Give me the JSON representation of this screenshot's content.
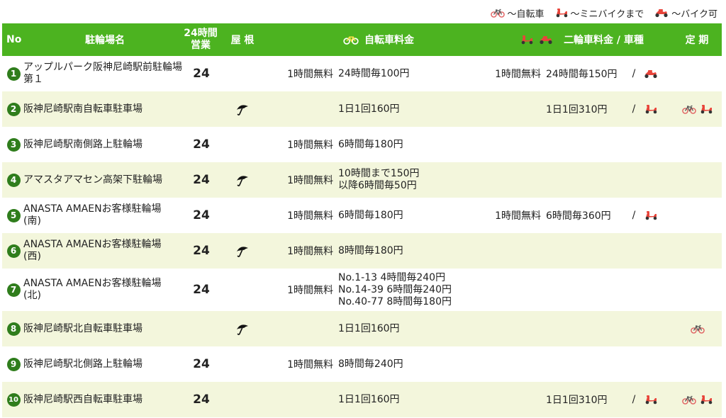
{
  "legend": [
    {
      "icon": "bicycle-icon",
      "label": "～自転車"
    },
    {
      "icon": "scooter-icon",
      "label": "～ミニバイクまで"
    },
    {
      "icon": "motorbike-icon",
      "label": "～バイク可"
    }
  ],
  "header": {
    "no": "No",
    "name": "駐輪場名",
    "hours_line1": "24時間",
    "hours_line2": "営業",
    "roof": "屋 根",
    "bike_fee": "自転車料金",
    "moto_fee": "二輪車料金 / 車種",
    "teiki": "定 期"
  },
  "rows": [
    {
      "no": "1",
      "name": "アップルパーク阪神尼崎駅前駐輪場第１",
      "hours": "24",
      "roof": false,
      "bike_free": "1時間無料",
      "bike_fee": "24時間毎100円",
      "moto_free": "1時間無料",
      "moto_fee": "24時間毎150円",
      "slash": "/",
      "moto_type": "motorbike",
      "teiki": []
    },
    {
      "no": "2",
      "name": "阪神尼崎駅南自転車駐車場",
      "hours": "",
      "roof": true,
      "bike_free": "",
      "bike_fee": "1日1回160円",
      "moto_free": "",
      "moto_fee": "1日1回310円",
      "slash": "/",
      "moto_type": "scooter",
      "teiki": [
        "bicycle",
        "scooter"
      ]
    },
    {
      "no": "3",
      "name": "阪神尼崎駅南側路上駐輪場",
      "hours": "24",
      "roof": false,
      "bike_free": "1時間無料",
      "bike_fee": "6時間毎180円",
      "moto_free": "",
      "moto_fee": "",
      "slash": "",
      "moto_type": "",
      "teiki": []
    },
    {
      "no": "4",
      "name": "アマスタアマセン高架下駐輪場",
      "hours": "24",
      "roof": true,
      "bike_free": "1時間無料",
      "bike_fee": "10時間まで150円\n以降6時間毎50円",
      "moto_free": "",
      "moto_fee": "",
      "slash": "",
      "moto_type": "",
      "teiki": []
    },
    {
      "no": "5",
      "name": "ANASTA AMAENお客様駐輪場\n(南)",
      "hours": "24",
      "roof": false,
      "bike_free": "1時間無料",
      "bike_fee": "6時間毎180円",
      "moto_free": "1時間無料",
      "moto_fee": "6時間毎360円",
      "slash": "/",
      "moto_type": "scooter",
      "teiki": []
    },
    {
      "no": "6",
      "name": "ANASTA AMAENお客様駐輪場\n(西)",
      "hours": "24",
      "roof": true,
      "bike_free": "1時間無料",
      "bike_fee": "8時間毎180円",
      "moto_free": "",
      "moto_fee": "",
      "slash": "",
      "moto_type": "",
      "teiki": []
    },
    {
      "no": "7",
      "name": "ANASTA AMAENお客様駐輪場\n(北)",
      "hours": "24",
      "roof": false,
      "bike_free": "1時間無料",
      "bike_fee": "No.1-13 4時間毎240円\nNo.14-39 6時間毎240円\nNo.40-77 8時間毎180円",
      "moto_free": "",
      "moto_fee": "",
      "slash": "",
      "moto_type": "",
      "teiki": []
    },
    {
      "no": "8",
      "name": "阪神尼崎駅北自転車駐車場",
      "hours": "",
      "roof": true,
      "bike_free": "",
      "bike_fee": "1日1回160円",
      "moto_free": "",
      "moto_fee": "",
      "slash": "",
      "moto_type": "",
      "teiki": [
        "bicycle"
      ]
    },
    {
      "no": "9",
      "name": "阪神尼崎駅北側路上駐輪場",
      "hours": "24",
      "roof": false,
      "bike_free": "1時間無料",
      "bike_fee": "8時間毎240円",
      "moto_free": "",
      "moto_fee": "",
      "slash": "",
      "moto_type": "",
      "teiki": []
    },
    {
      "no": "10",
      "name": "阪神尼崎駅西自転車駐車場",
      "hours": "24",
      "roof": false,
      "bike_free": "",
      "bike_fee": "1日1回160円",
      "moto_free": "",
      "moto_fee": "1日1回310円",
      "slash": "/",
      "moto_type": "scooter",
      "teiki": [
        "bicycle",
        "scooter"
      ]
    }
  ],
  "colors": {
    "header_bg": "#4cb320",
    "row_alt": "#f3f6dc",
    "number_circle": "#2f7d1c",
    "vehicle_red": "#e8443a"
  }
}
